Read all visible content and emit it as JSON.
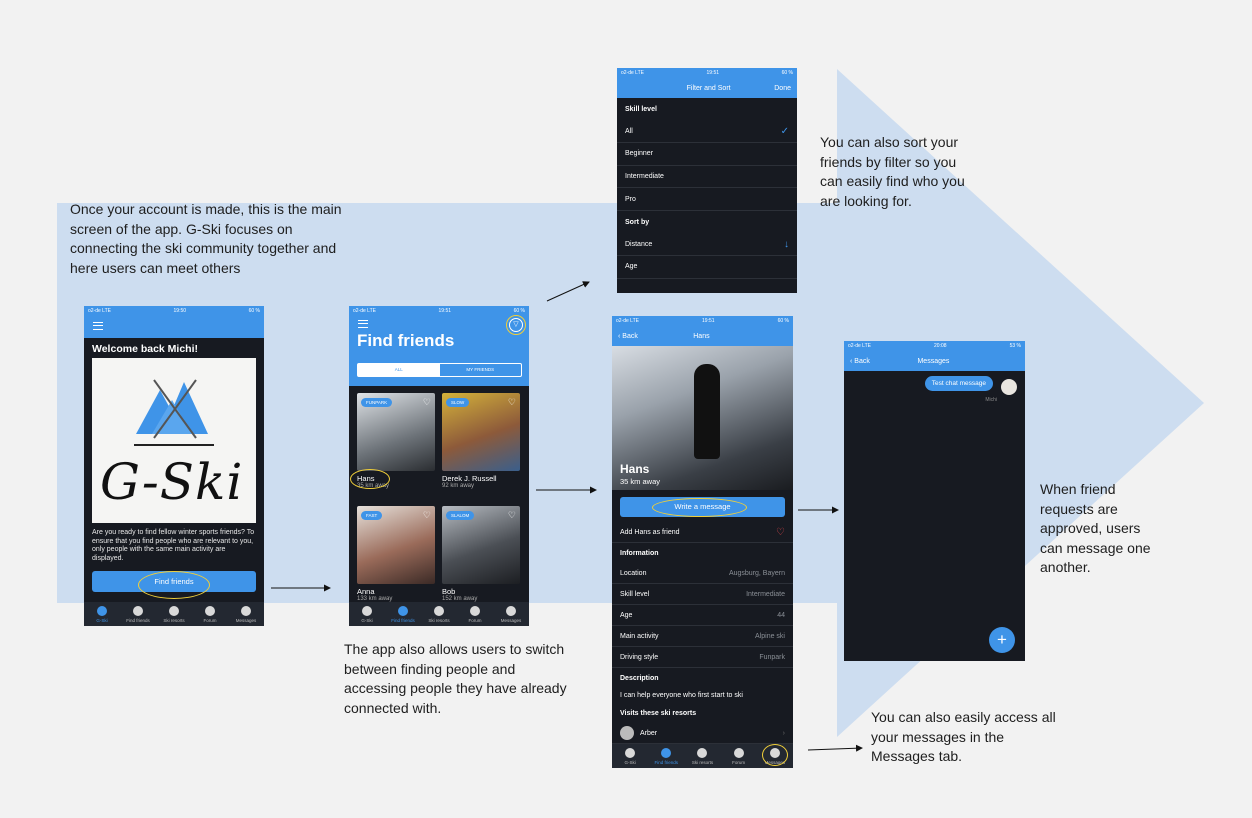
{
  "captions": {
    "main": "Once your account is made, this is the main screen of the app. G-Ski focuses on connecting the ski community together and here users can meet others",
    "filter": "You can also sort your friends by filter so you can easily find who you are looking for.",
    "find": "The app also allows users to switch between finding people and accessing people they have already connected with.",
    "requests": "When  friend requests are approved, users can message one another.",
    "messages": "You can also easily access all your messages in the Messages tab."
  },
  "status": {
    "carrier": "o2-de  LTE",
    "battery": "60 %"
  },
  "times": {
    "home": "19:50",
    "find": "19:51",
    "filter": "19:51",
    "profile": "19:51",
    "chat": "20:08"
  },
  "home": {
    "welcome": "Welcome back Michi!",
    "logo_text": "G-Ski",
    "intro": "Are you ready to find fellow winter sports friends? To ensure that you find people who are relevant to you, only people with the same main activity are displayed.",
    "cta": "Find friends"
  },
  "tabs": [
    "G-Ski",
    "Find friends",
    "Ski resorts",
    "Forum",
    "Messages"
  ],
  "find": {
    "title": "Find friends",
    "seg_all": "ALL",
    "seg_my": "MY FRIENDS",
    "people": [
      {
        "badge": "FUNPARK",
        "name": "Hans",
        "dist": "35 km away"
      },
      {
        "badge": "SLOW",
        "name": "Derek J. Russell",
        "dist": "92 km away"
      },
      {
        "badge": "FAST",
        "name": "Anna",
        "dist": "133 km away"
      },
      {
        "badge": "SLALOM",
        "name": "Bob",
        "dist": "152 km away"
      }
    ]
  },
  "filter": {
    "title": "Filter and Sort",
    "done": "Done",
    "skill_header": "Skill level",
    "skill": [
      "All",
      "Beginner",
      "Intermediate",
      "Pro"
    ],
    "sort_header": "Sort by",
    "sort": [
      "Distance",
      "Age"
    ]
  },
  "profile": {
    "back": "Back",
    "title": "Hans",
    "name": "Hans",
    "dist": "35 km away",
    "cta": "Write a message",
    "add_friend": "Add Hans as friend",
    "info_header": "Information",
    "info": [
      {
        "k": "Location",
        "v": "Augsburg, Bayern"
      },
      {
        "k": "Skill level",
        "v": "Intermediate"
      },
      {
        "k": "Age",
        "v": "44"
      },
      {
        "k": "Main activity",
        "v": "Alpine ski"
      },
      {
        "k": "Driving style",
        "v": "Funpark"
      }
    ],
    "desc_header": "Description",
    "desc": "I can help everyone who first start to ski",
    "resorts_header": "Visits these ski resorts",
    "resort": "Arber"
  },
  "chat": {
    "back": "Back",
    "title": "Messages",
    "message": "Test chat message",
    "sender": "Michi",
    "battery": "53 %"
  },
  "colors": {
    "accent": "#3f94e8",
    "dark": "#171a21",
    "band": "#cdddf0",
    "highlight": "#f0cf3a"
  }
}
